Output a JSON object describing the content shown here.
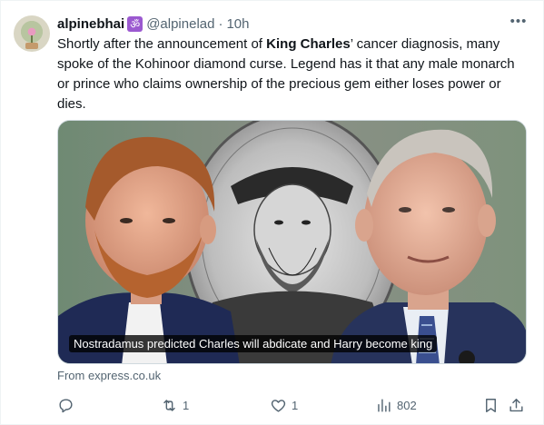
{
  "author": {
    "display_name": "alpinebhai",
    "badge_icon": "om-symbol-icon",
    "badge_glyph": "ॐ",
    "handle": "@alpinelad",
    "separator": "·",
    "time": "10h"
  },
  "more_glyph": "•••",
  "text": {
    "part1": "Shortly after the announcement of ",
    "bold": "King Charles",
    "part2": "’ cancer diagnosis, many spoke of the Kohinoor diamond curse. Legend has it that any male monarch or prince who claims ownership of the precious gem either loses power or dies."
  },
  "media": {
    "caption": "Nostradamus predicted Charles will abdicate and Harry become king"
  },
  "source": "From express.co.uk",
  "actions": {
    "reply_icon": "reply-icon",
    "retweet_icon": "retweet-icon",
    "retweet_count": "1",
    "like_icon": "heart-icon",
    "like_count": "1",
    "views_icon": "views-bar-chart-icon",
    "views_count": "802",
    "bookmark_icon": "bookmark-icon",
    "share_icon": "share-icon"
  },
  "colors": {
    "text": "#0f1419",
    "secondary": "#536471",
    "badge": "#9b59d0"
  }
}
